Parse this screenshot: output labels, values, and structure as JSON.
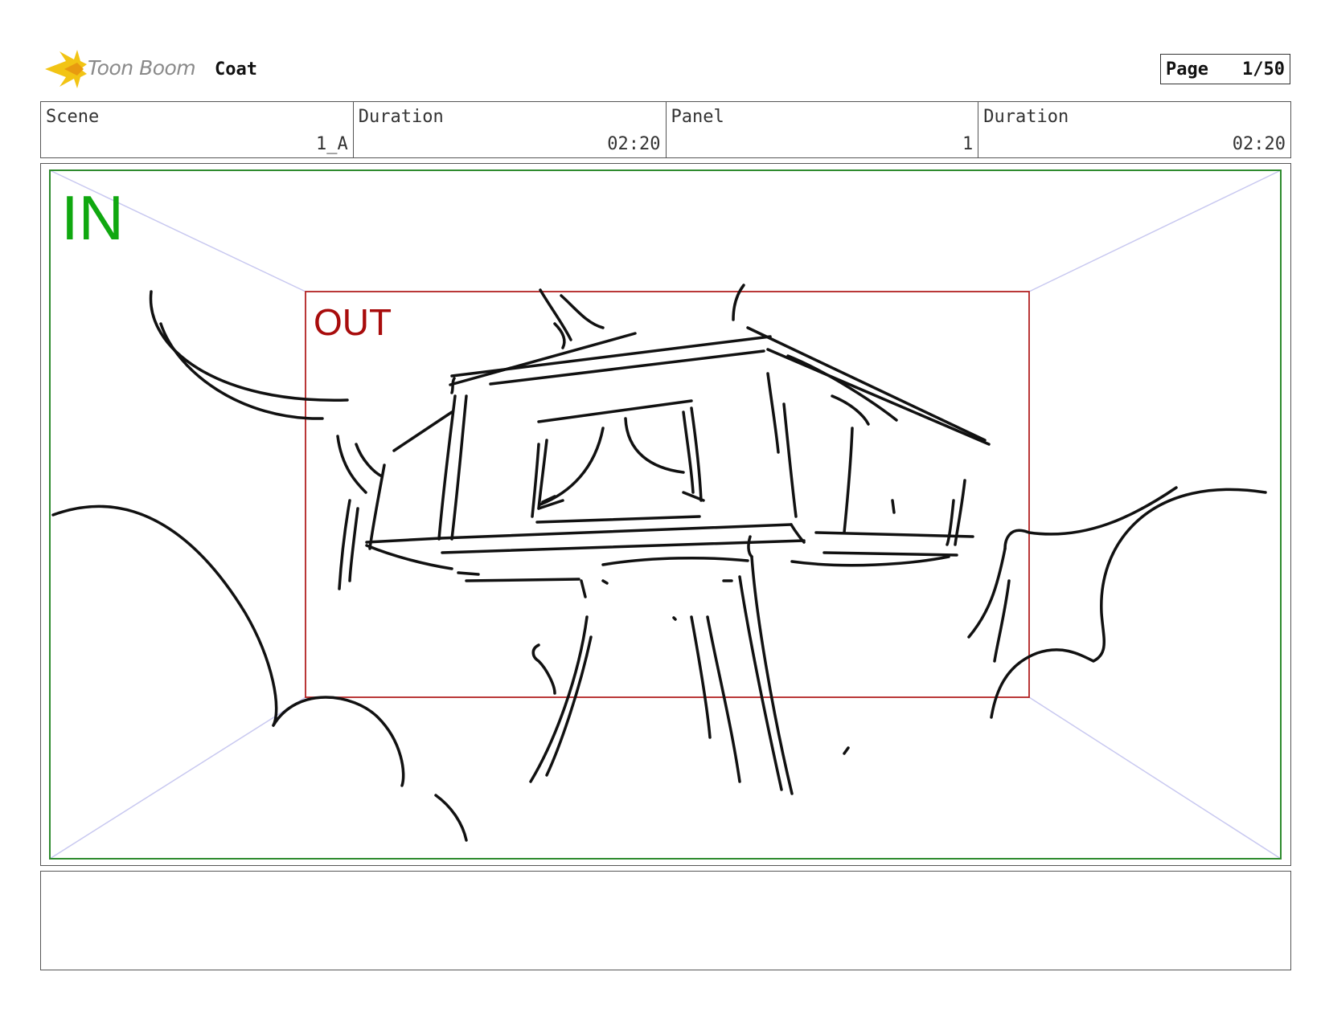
{
  "header": {
    "brand": "Toon Boom",
    "project_title": "Coat",
    "page_label": "Page",
    "page_value": "1/50"
  },
  "info": {
    "scene_label": "Scene",
    "scene_value": "1_A",
    "scene_duration_label": "Duration",
    "scene_duration_value": "02:20",
    "panel_label": "Panel",
    "panel_value": "1",
    "panel_duration_label": "Duration",
    "panel_duration_value": "02:20"
  },
  "panel": {
    "in_label": "IN",
    "out_label": "OUT",
    "colors": {
      "in_frame": "#2e8b2e",
      "out_frame": "#b22222",
      "guides": "#c8c8f0"
    }
  },
  "notes": {
    "text": ""
  }
}
